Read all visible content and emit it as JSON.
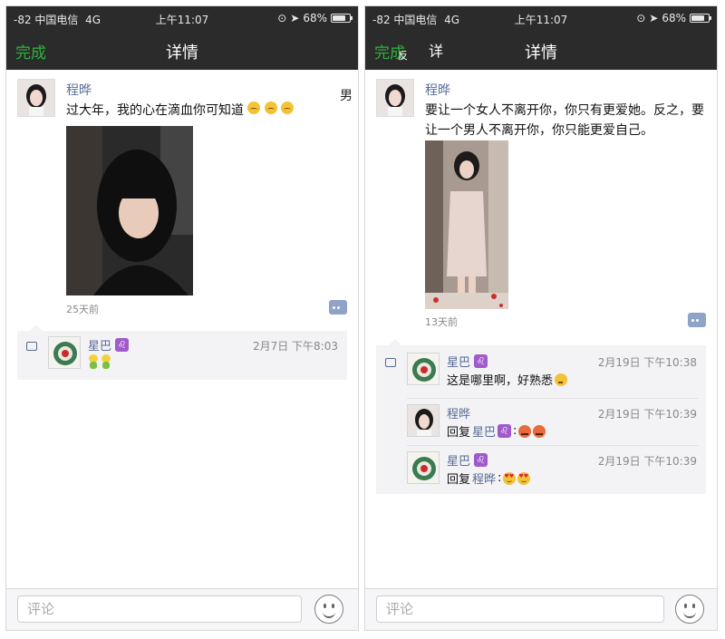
{
  "colors": {
    "accent_green": "#2db33d",
    "name_blue": "#576b95",
    "bar_dark": "#2b2b2b"
  },
  "left": {
    "status": {
      "signal": "-82 中国电信",
      "network": "4G",
      "time": "上午11:07",
      "battery": "68%",
      "battery_level": 0.68
    },
    "nav": {
      "back_label": "完成",
      "title": "详情"
    },
    "post": {
      "author": "程晔",
      "text": "过大年，我的心在滴血你可知道",
      "time": "25天前"
    },
    "comments": [
      {
        "name": "星巴",
        "zodiac": "♌",
        "time": "2月7日 下午8:03",
        "text": ""
      }
    ],
    "input": {
      "placeholder": "评论"
    }
  },
  "right": {
    "status": {
      "signal": "-82 中国电信",
      "network": "4G",
      "time": "上午11:07",
      "battery": "68%",
      "battery_level": 0.68
    },
    "nav": {
      "back_label": "完成",
      "title": "详情"
    },
    "post": {
      "author": "程晔",
      "text": "要让一个女人不离开你，你只有更爱她。反之，要让一个男人不离开你，你只能更爱自己。",
      "time": "13天前"
    },
    "comments": [
      {
        "name": "星巴",
        "zodiac": "♌",
        "time": "2月19日 下午10:38",
        "text": "这是哪里啊，好熟悉"
      },
      {
        "name": "程晔",
        "time": "2月19日 下午10:39",
        "reply_prefix": "回复",
        "reply_to": "星巴",
        "zodiac": "♌",
        "colon": ": "
      },
      {
        "name": "星巴",
        "zodiac": "♌",
        "time": "2月19日 下午10:39",
        "reply_prefix": "回复",
        "reply_to": "程晔",
        "colon": ": "
      }
    ],
    "input": {
      "placeholder": "评论"
    }
  },
  "overlay_marks": [
    "男",
    "反",
    "详"
  ]
}
